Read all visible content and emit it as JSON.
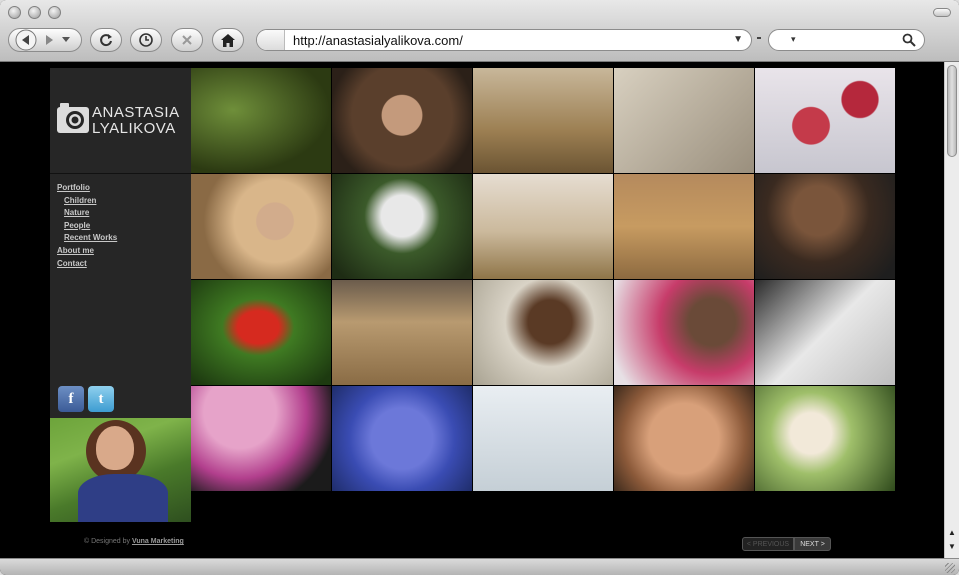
{
  "browser": {
    "url": "http://anastasialyalikova.com/"
  },
  "site": {
    "logo_line1": "ANASTASIA",
    "logo_line2": "LYALIKOVA",
    "nav": [
      {
        "label": "Portfolio",
        "sub": false
      },
      {
        "label": "Children",
        "sub": true
      },
      {
        "label": "Nature",
        "sub": true
      },
      {
        "label": "People",
        "sub": true
      },
      {
        "label": "Recent Works",
        "sub": true
      },
      {
        "label": "About me",
        "sub": false
      },
      {
        "label": "Contact",
        "sub": false
      }
    ],
    "social": {
      "facebook": "f",
      "twitter": "t"
    },
    "footer_prefix": "© Designed by ",
    "footer_link": "Vuna Marketing",
    "pager": {
      "prev": "< PREVIOUS",
      "next": "NEXT >"
    }
  },
  "gallery": [
    {
      "subject": "green leaves"
    },
    {
      "subject": "woman in fur hood"
    },
    {
      "subject": "girl with camera in field"
    },
    {
      "subject": "smiling boy"
    },
    {
      "subject": "red fuchsia flowers"
    },
    {
      "subject": "blonde woman in field"
    },
    {
      "subject": "woman in white hat with pine"
    },
    {
      "subject": "jumping in field"
    },
    {
      "subject": "hair in wind field"
    },
    {
      "subject": "boy portrait"
    },
    {
      "subject": "red tulip"
    },
    {
      "subject": "two girls in grass field"
    },
    {
      "subject": "smiling boy outdoors"
    },
    {
      "subject": "girl with braids and beads"
    },
    {
      "subject": "hat silhouette"
    },
    {
      "subject": "pink flower with insect"
    },
    {
      "subject": "blue plumbago flowers"
    },
    {
      "subject": "girl with hat on beach"
    },
    {
      "subject": "baby face"
    },
    {
      "subject": "lantana flowers"
    }
  ]
}
